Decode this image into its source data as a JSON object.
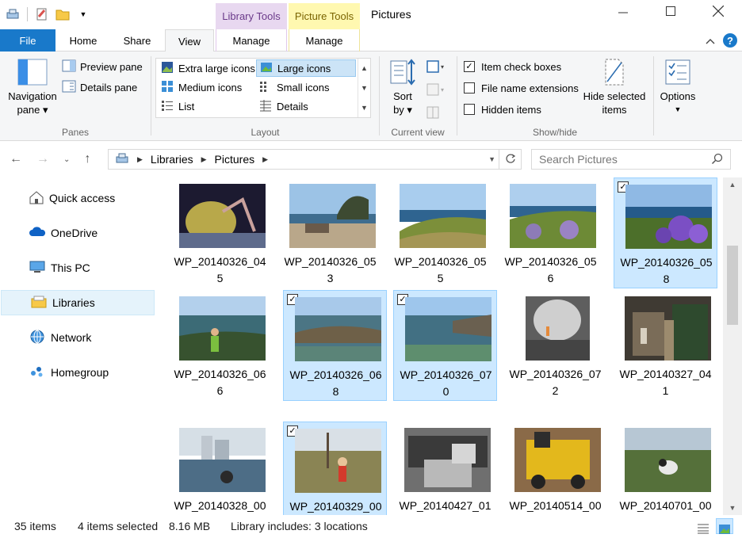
{
  "window": {
    "title": "Pictures",
    "context_tabs": [
      "Library Tools",
      "Picture Tools"
    ]
  },
  "tabs": {
    "file": "File",
    "home": "Home",
    "share": "Share",
    "view": "View",
    "manage1": "Manage",
    "manage2": "Manage"
  },
  "ribbon": {
    "panes": {
      "label": "Panes",
      "navigation_pane": [
        "Navigation",
        "pane"
      ],
      "preview_pane": "Preview pane",
      "details_pane": "Details pane"
    },
    "layout": {
      "label": "Layout",
      "items": [
        "Extra large icons",
        "Large icons",
        "Medium icons",
        "Small icons",
        "List",
        "Details"
      ],
      "selected": "Large icons"
    },
    "current_view": {
      "label": "Current view",
      "sort_by": [
        "Sort",
        "by"
      ]
    },
    "show_hide": {
      "label": "Show/hide",
      "item_check_boxes": "Item check boxes",
      "file_name_extensions": "File name extensions",
      "hidden_items": "Hidden items",
      "item_check_boxes_checked": true,
      "file_name_extensions_checked": false,
      "hidden_items_checked": false,
      "hide_selected": [
        "Hide selected",
        "items"
      ]
    },
    "options": {
      "label": "Options"
    }
  },
  "address": {
    "crumbs": [
      "Libraries",
      "Pictures"
    ],
    "search_placeholder": "Search Pictures"
  },
  "nav": {
    "items": [
      "Quick access",
      "OneDrive",
      "This PC",
      "Libraries",
      "Network",
      "Homegroup"
    ],
    "selected": "Libraries"
  },
  "files": [
    {
      "name": [
        "WP_20140326_04",
        "5"
      ],
      "selected": false
    },
    {
      "name": [
        "WP_20140326_05",
        "3"
      ],
      "selected": false
    },
    {
      "name": [
        "WP_20140326_05",
        "5"
      ],
      "selected": false
    },
    {
      "name": [
        "WP_20140326_05",
        "6"
      ],
      "selected": false
    },
    {
      "name": [
        "WP_20140326_05",
        "8"
      ],
      "selected": true
    },
    {
      "name": [
        "WP_20140326_06",
        "6"
      ],
      "selected": false
    },
    {
      "name": [
        "WP_20140326_06",
        "8"
      ],
      "selected": true
    },
    {
      "name": [
        "WP_20140326_07",
        "0"
      ],
      "selected": true
    },
    {
      "name": [
        "WP_20140326_07",
        "2"
      ],
      "selected": false
    },
    {
      "name": [
        "WP_20140327_04",
        "1"
      ],
      "selected": false
    },
    {
      "name": [
        "WP_20140328_00",
        ""
      ],
      "selected": false
    },
    {
      "name": [
        "WP_20140329_00",
        ""
      ],
      "selected": true
    },
    {
      "name": [
        "WP_20140427_01",
        ""
      ],
      "selected": false
    },
    {
      "name": [
        "WP_20140514_00",
        ""
      ],
      "selected": false
    },
    {
      "name": [
        "WP_20140701_00",
        ""
      ],
      "selected": false
    }
  ],
  "status": {
    "item_count": "35 items",
    "selected": "4 items selected",
    "size": "8.16 MB",
    "library": "Library includes: 3 locations"
  },
  "colors": {
    "accent": "#1979ca",
    "selection": "#cce8ff",
    "selection_border": "#99d1ff"
  }
}
